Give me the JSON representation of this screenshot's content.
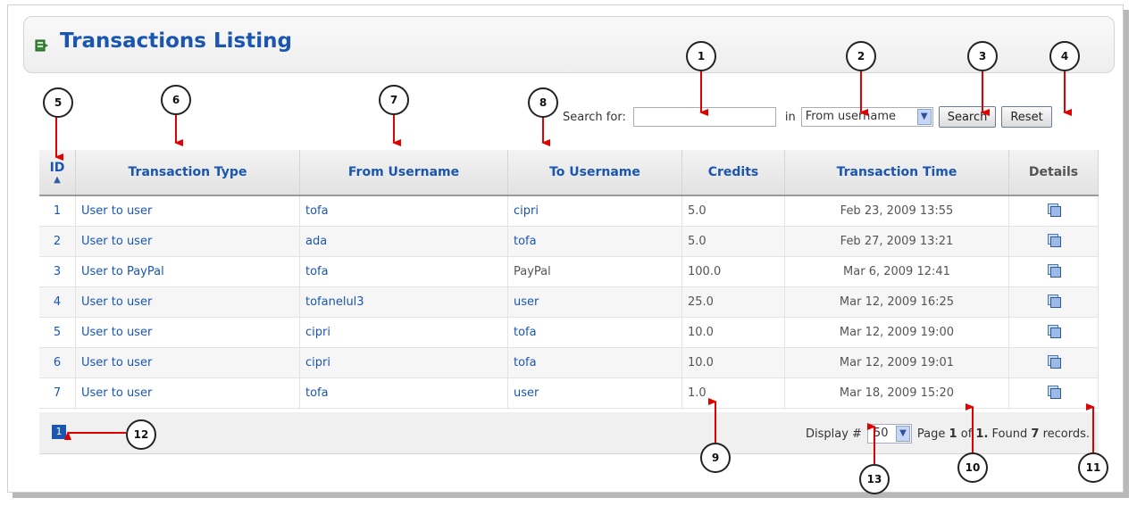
{
  "header": {
    "title": "Transactions Listing"
  },
  "search": {
    "label": "Search for:",
    "value": "",
    "in_label": "in",
    "field_selected": "From username",
    "search_button": "Search",
    "reset_button": "Reset"
  },
  "table": {
    "headers": [
      "ID",
      "Transaction Type",
      "From Username",
      "To Username",
      "Credits",
      "Transaction Time",
      "Details"
    ],
    "sort_indicator": "▲",
    "rows": [
      {
        "id": "1",
        "type": "User to user",
        "from": "tofa",
        "to": "cipri",
        "credits": "5.0",
        "time": "Feb 23, 2009 13:55"
      },
      {
        "id": "2",
        "type": "User to user",
        "from": "ada",
        "to": "tofa",
        "credits": "5.0",
        "time": "Feb 27, 2009 13:21"
      },
      {
        "id": "3",
        "type": "User to PayPal",
        "from": "tofa",
        "to": "PayPal",
        "credits": "100.0",
        "time": "Mar 6, 2009 12:41"
      },
      {
        "id": "4",
        "type": "User to user",
        "from": "tofanelul3",
        "to": "user",
        "credits": "25.0",
        "time": "Mar 12, 2009 16:25"
      },
      {
        "id": "5",
        "type": "User to user",
        "from": "cipri",
        "to": "tofa",
        "credits": "10.0",
        "time": "Mar 12, 2009 19:00"
      },
      {
        "id": "6",
        "type": "User to user",
        "from": "cipri",
        "to": "tofa",
        "credits": "10.0",
        "time": "Mar 12, 2009 19:01"
      },
      {
        "id": "7",
        "type": "User to user",
        "from": "tofa",
        "to": "user",
        "credits": "1.0",
        "time": "Mar 18, 2009 15:20"
      }
    ]
  },
  "pager": {
    "current_page": "1",
    "display_label": "Display #",
    "display_value": "50",
    "page_word": "Page",
    "page_num": "1",
    "of_word": "of",
    "total_pages": "1.",
    "found_word": "Found",
    "record_count": "7",
    "records_word": "records."
  },
  "callouts": [
    "1",
    "2",
    "3",
    "4",
    "5",
    "6",
    "7",
    "8",
    "9",
    "10",
    "11",
    "12",
    "13"
  ],
  "colors": {
    "accent": "#1a56b0",
    "arrow": "#e00000"
  }
}
